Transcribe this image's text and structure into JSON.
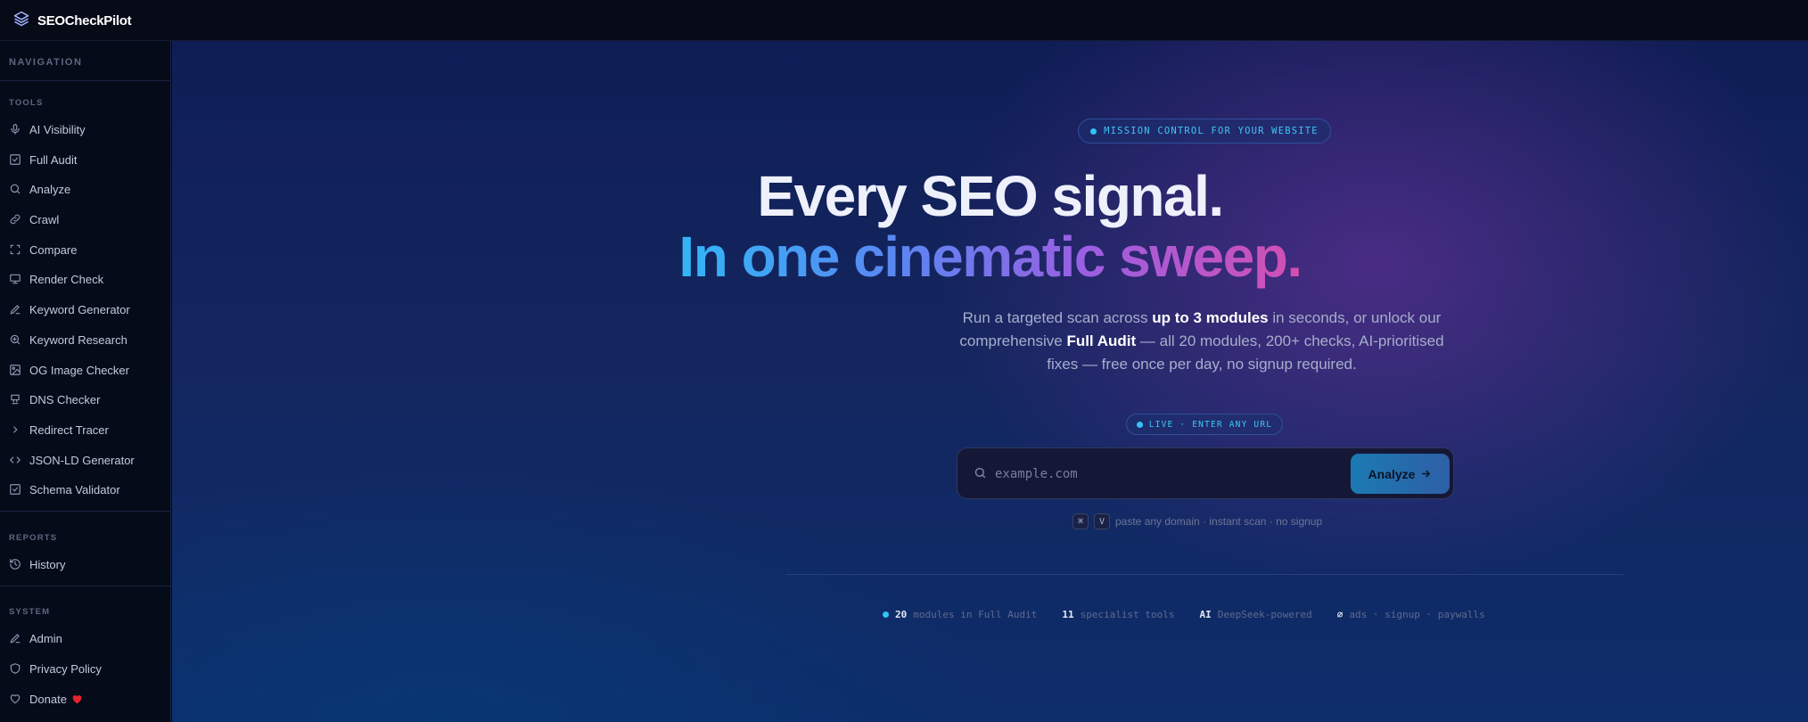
{
  "app": {
    "name": "SEOCheckPilot"
  },
  "sidebar": {
    "heading": "NAVIGATION",
    "sections": [
      {
        "label": "TOOLS"
      },
      {
        "label": "REPORTS"
      },
      {
        "label": "SYSTEM"
      }
    ],
    "tools": [
      {
        "label": "AI Visibility",
        "icon": "microphone-icon"
      },
      {
        "label": "Full Audit",
        "icon": "checkbox-icon"
      },
      {
        "label": "Analyze",
        "icon": "search-icon"
      },
      {
        "label": "Crawl",
        "icon": "link-icon"
      },
      {
        "label": "Compare",
        "icon": "frame-icon"
      },
      {
        "label": "Render Check",
        "icon": "monitor-icon"
      },
      {
        "label": "Keyword Generator",
        "icon": "pen-icon"
      },
      {
        "label": "Keyword Research",
        "icon": "zoom-in-icon"
      },
      {
        "label": "OG Image Checker",
        "icon": "image-icon"
      },
      {
        "label": "DNS Checker",
        "icon": "server-icon"
      },
      {
        "label": "Redirect Tracer",
        "icon": "chevron-right-icon"
      },
      {
        "label": "JSON-LD Generator",
        "icon": "code-icon"
      },
      {
        "label": "Schema Validator",
        "icon": "checkbox-icon"
      }
    ],
    "reports": [
      {
        "label": "History",
        "icon": "history-icon"
      }
    ],
    "system": [
      {
        "label": "Admin",
        "icon": "pen-icon"
      },
      {
        "label": "Privacy Policy",
        "icon": "shield-icon"
      },
      {
        "label": "Donate",
        "icon": "heart-outline-icon",
        "suffix_icon": "heart-filled-icon"
      }
    ]
  },
  "hero": {
    "badge": "MISSION CONTROL FOR YOUR WEBSITE",
    "title_line1": "Every SEO signal.",
    "title_line2": "In one cinematic sweep.",
    "subtitle": {
      "p1": "Run a targeted scan across ",
      "b1": "up to 3 modules",
      "p2": " in seconds, or unlock our comprehensive ",
      "b2": "Full Audit",
      "p3": " — all 20 modules, 200+ checks, AI-prioritised fixes — free once per day, no signup required."
    },
    "live_badge": "LIVE · ENTER ANY URL",
    "search": {
      "placeholder": "example.com",
      "value": "",
      "button": "Analyze",
      "button_icon": "arrow-right-icon"
    },
    "hint": {
      "keys": [
        "⌘",
        "V"
      ],
      "text": "paste any domain · instant scan · no signup"
    },
    "stats": [
      {
        "value": "20",
        "label": "modules in Full Audit",
        "dot": true
      },
      {
        "value": "11",
        "label": "specialist tools"
      },
      {
        "value": "AI",
        "label": "DeepSeek-powered"
      },
      {
        "value": "∅",
        "label": "ads · signup · paywalls"
      }
    ]
  },
  "colors": {
    "accent_cyan": "#33c3f5",
    "gradient_start": "#32b6f7",
    "gradient_end": "#d34fb3",
    "heart": "#e5232f"
  }
}
